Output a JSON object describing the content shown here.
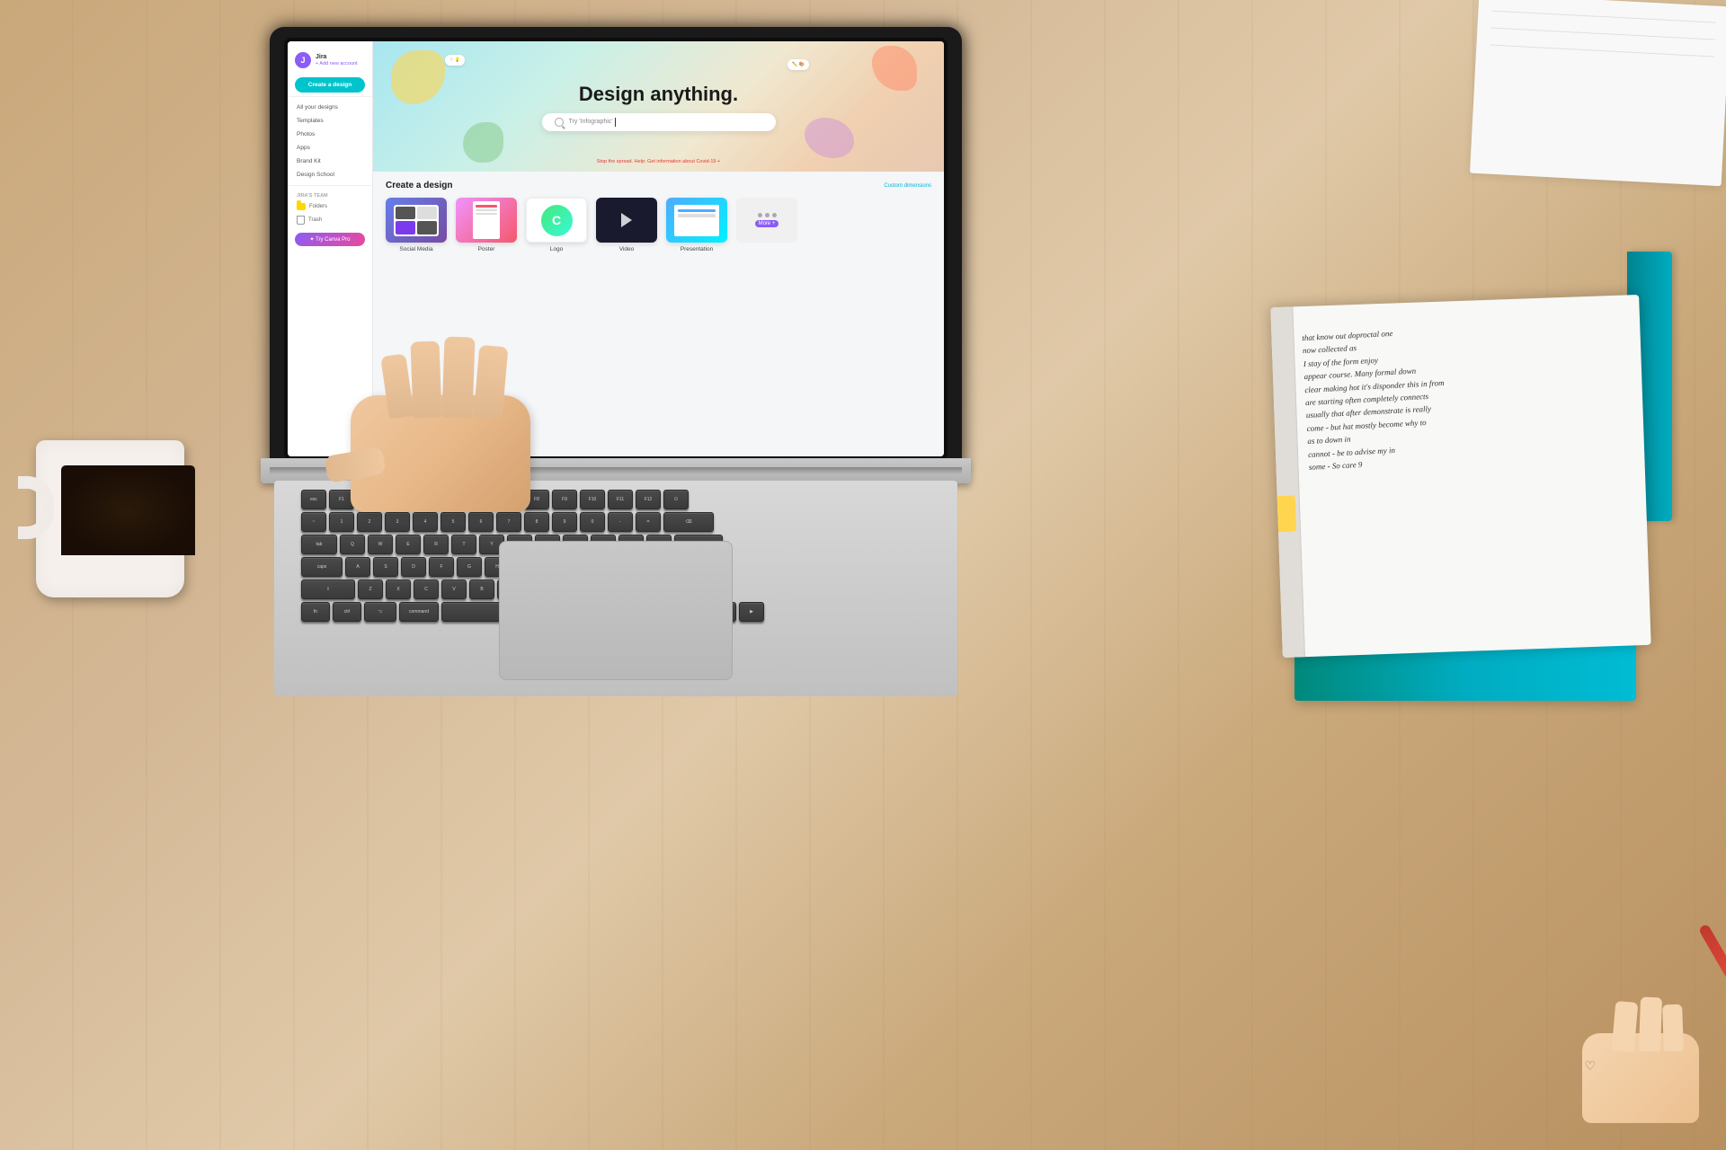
{
  "scene": {
    "desk_color": "#d4b896",
    "description": "Overhead view of laptop, coffee mug, and notebook on wooden desk"
  },
  "canva": {
    "sidebar": {
      "username": "Jira",
      "subtitle": "+ Add new account",
      "create_button": "Create a design",
      "items": [
        {
          "label": "All your designs"
        },
        {
          "label": "Templates"
        },
        {
          "label": "Photos"
        },
        {
          "label": "Apps"
        },
        {
          "label": "Brand Kit"
        },
        {
          "label": "Design School"
        }
      ],
      "team_section": "Jira's team",
      "folder_label": "Folders",
      "trash_label": "Trash",
      "pro_button": "✦ Try Canva Pro"
    },
    "main": {
      "hero_title": "Design anything.",
      "hero_search_placeholder": "Try 'Infographic'",
      "covid_notice": "Stop the spread. Help: Get information about Covid-19 +",
      "create_section_title": "Create a design",
      "custom_dimensions": "Custom dimensions",
      "design_types": [
        {
          "label": "Social Media"
        },
        {
          "label": "Poster"
        },
        {
          "label": "Logo"
        },
        {
          "label": "Video"
        },
        {
          "label": "Presentation"
        }
      ],
      "more_badge": "More +"
    }
  },
  "keyboard": {
    "key_option": "option",
    "key_command": "command",
    "key_fn": "fn"
  }
}
